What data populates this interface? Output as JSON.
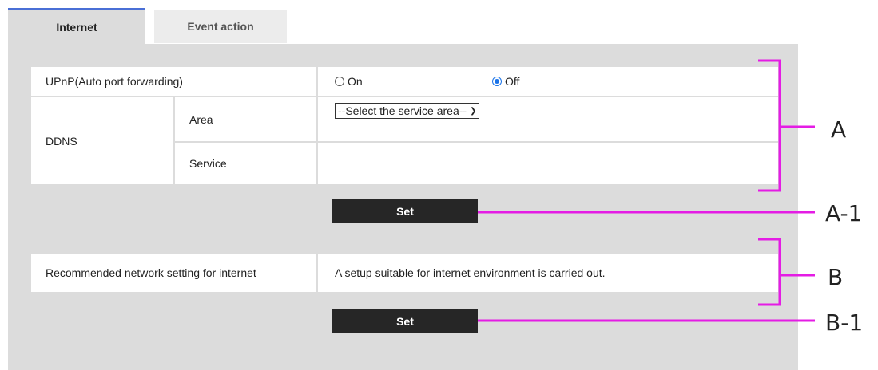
{
  "tabs": [
    {
      "label": "Internet",
      "active": true
    },
    {
      "label": "Event action",
      "active": false
    }
  ],
  "upnp": {
    "label": "UPnP(Auto port forwarding)",
    "options": [
      {
        "label": "On",
        "checked": false
      },
      {
        "label": "Off",
        "checked": true
      }
    ]
  },
  "ddns": {
    "label": "DDNS",
    "area_label": "Area",
    "area_select_value": "--Select the service area--",
    "service_label": "Service"
  },
  "set_label": "Set",
  "recommended": {
    "label": "Recommended network setting for internet",
    "description": "A setup suitable for internet environment is carried out."
  },
  "annotations": {
    "A": "A",
    "A1": "A-1",
    "B": "B",
    "B1": "B-1"
  },
  "colors": {
    "panel": "#dcdcdc",
    "button": "#262626",
    "tab_accent": "#4a6fd6",
    "annotation": "#e41ce4"
  }
}
